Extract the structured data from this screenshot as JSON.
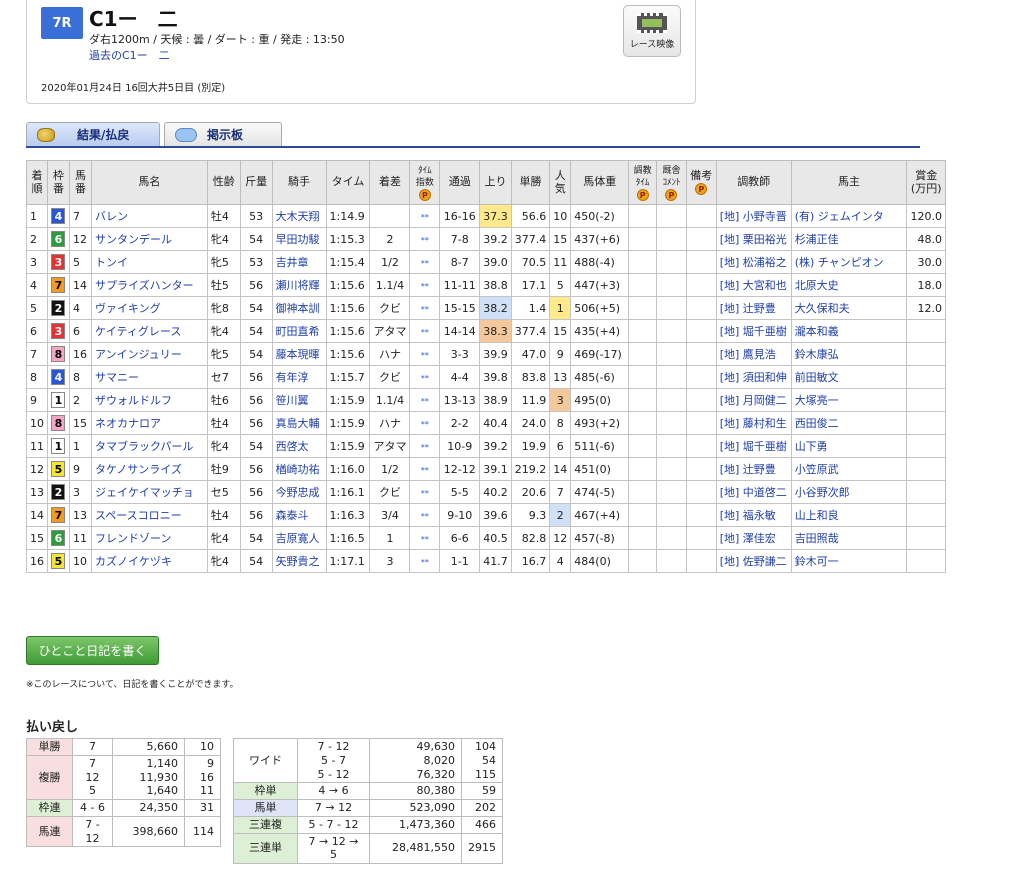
{
  "header": {
    "race_no": "7R",
    "race_name": "C1ー　二",
    "conditions": "ダ右1200m / 天候 : 曇 / ダート : 重 / 発走 : 13:50",
    "past_link": "過去のC1ー　二",
    "date": "2020年01月24日 16回大井5日目 (別定)",
    "video_label": "レース映像"
  },
  "tabs": [
    {
      "label": "結果/払戻"
    },
    {
      "label": "掲示板"
    }
  ],
  "table": {
    "headers": [
      "着順",
      "枠番",
      "馬番",
      "馬名",
      "性齢",
      "斤量",
      "騎手",
      "タイム",
      "着差",
      "タイム指数",
      "通過",
      "上り",
      "単勝",
      "人気",
      "馬体重",
      "調教タイム",
      "厩舎コメント",
      "備考",
      "調教師",
      "馬主",
      "賞金(万円)"
    ],
    "header_display": {
      "chakujun": "着\n順",
      "waku": "枠\n番",
      "uma": "馬\n番",
      "name": "馬名",
      "sexage": "性齢",
      "kinryo": "斤量",
      "jockey": "騎手",
      "time": "タイム",
      "margin": "着差",
      "index": "ﾀｲﾑ\n指数",
      "pass": "通過",
      "agari": "上り",
      "odds": "単勝",
      "pop": "人\n気",
      "weight": "馬体重",
      "chokyo": "調教\nﾀｲﾑ",
      "comment": "厩舎\nｺﾒﾝﾄ",
      "biko": "備考",
      "trainer": "調教師",
      "owner": "馬主",
      "prize": "賞金\n(万円)"
    },
    "p_mark": "P",
    "index_mark": "**",
    "rows": [
      {
        "rank": "1",
        "waku": "4",
        "uma": "7",
        "name": "バレン",
        "sexage": "牡4",
        "kinryo": "53",
        "jockey": "大木天翔",
        "time": "1:14.9",
        "margin": "",
        "pass": "16-16",
        "agari": "37.3",
        "agari_hl": "y",
        "odds": "56.6",
        "pop": "10",
        "pop_hl": "",
        "weight": "450(-2)",
        "trainer": "[地] 小野寺晋",
        "owner": "(有) ジェムインタ",
        "prize": "120.0"
      },
      {
        "rank": "2",
        "waku": "6",
        "uma": "12",
        "name": "サンタンデール",
        "sexage": "牝4",
        "kinryo": "54",
        "jockey": "早田功駿",
        "time": "1:15.3",
        "margin": "2",
        "pass": "7-8",
        "agari": "39.2",
        "agari_hl": "",
        "odds": "377.4",
        "pop": "15",
        "pop_hl": "",
        "weight": "437(+6)",
        "trainer": "[地] 栗田裕光",
        "owner": "杉浦正佳",
        "prize": "48.0"
      },
      {
        "rank": "3",
        "waku": "3",
        "uma": "5",
        "name": "トンイ",
        "sexage": "牝5",
        "kinryo": "53",
        "jockey": "吉井章",
        "time": "1:15.4",
        "margin": "1/2",
        "pass": "8-7",
        "agari": "39.0",
        "agari_hl": "",
        "odds": "70.5",
        "pop": "11",
        "pop_hl": "",
        "weight": "488(-4)",
        "trainer": "[地] 松浦裕之",
        "owner": "(株) チャンピオン",
        "prize": "30.0"
      },
      {
        "rank": "4",
        "waku": "7",
        "uma": "14",
        "name": "サプライズハンター",
        "sexage": "牡5",
        "kinryo": "56",
        "jockey": "瀬川将輝",
        "time": "1:15.6",
        "margin": "1.1/4",
        "pass": "11-11",
        "agari": "38.8",
        "agari_hl": "",
        "odds": "17.1",
        "pop": "5",
        "pop_hl": "",
        "weight": "447(+3)",
        "trainer": "[地] 大宮和也",
        "owner": "北原大史",
        "prize": "18.0"
      },
      {
        "rank": "5",
        "waku": "2",
        "uma": "4",
        "name": "ヴァイキング",
        "sexage": "牝8",
        "kinryo": "54",
        "jockey": "御神本訓",
        "time": "1:15.6",
        "margin": "クビ",
        "pass": "15-15",
        "agari": "38.2",
        "agari_hl": "b",
        "odds": "1.4",
        "pop": "1",
        "pop_hl": "y",
        "weight": "506(+5)",
        "trainer": "[地] 辻野豊",
        "owner": "大久保和夫",
        "prize": "12.0"
      },
      {
        "rank": "6",
        "waku": "3",
        "uma": "6",
        "name": "ケイティグレース",
        "sexage": "牝4",
        "kinryo": "54",
        "jockey": "町田直希",
        "time": "1:15.6",
        "margin": "アタマ",
        "pass": "14-14",
        "agari": "38.3",
        "agari_hl": "o",
        "odds": "377.4",
        "pop": "15",
        "pop_hl": "",
        "weight": "435(+4)",
        "trainer": "[地] 堀千亜樹",
        "owner": "瀧本和義",
        "prize": ""
      },
      {
        "rank": "7",
        "waku": "8",
        "uma": "16",
        "name": "アンインジュリー",
        "sexage": "牝5",
        "kinryo": "54",
        "jockey": "藤本現暉",
        "time": "1:15.6",
        "margin": "ハナ",
        "pass": "3-3",
        "agari": "39.9",
        "agari_hl": "",
        "odds": "47.0",
        "pop": "9",
        "pop_hl": "",
        "weight": "469(-17)",
        "trainer": "[地] 鷹見浩",
        "owner": "鈴木康弘",
        "prize": ""
      },
      {
        "rank": "8",
        "waku": "4",
        "uma": "8",
        "name": "サマニー",
        "sexage": "セ7",
        "kinryo": "56",
        "jockey": "有年淳",
        "time": "1:15.7",
        "margin": "クビ",
        "pass": "4-4",
        "agari": "39.8",
        "agari_hl": "",
        "odds": "83.8",
        "pop": "13",
        "pop_hl": "",
        "weight": "485(-6)",
        "trainer": "[地] 須田和伸",
        "owner": "前田敏文",
        "prize": ""
      },
      {
        "rank": "9",
        "waku": "1",
        "uma": "2",
        "name": "ザウォルドルフ",
        "sexage": "牡6",
        "kinryo": "56",
        "jockey": "笹川翼",
        "time": "1:15.9",
        "margin": "1.1/4",
        "pass": "13-13",
        "agari": "38.9",
        "agari_hl": "",
        "odds": "11.9",
        "pop": "3",
        "pop_hl": "o",
        "weight": "495(0)",
        "trainer": "[地] 月岡健二",
        "owner": "大塚亮一",
        "prize": ""
      },
      {
        "rank": "10",
        "waku": "8",
        "uma": "15",
        "name": "ネオカナロア",
        "sexage": "牡4",
        "kinryo": "56",
        "jockey": "真島大輔",
        "time": "1:15.9",
        "margin": "ハナ",
        "pass": "2-2",
        "agari": "40.4",
        "agari_hl": "",
        "odds": "24.0",
        "pop": "8",
        "pop_hl": "",
        "weight": "493(+2)",
        "trainer": "[地] 藤村和生",
        "owner": "西田俊二",
        "prize": ""
      },
      {
        "rank": "11",
        "waku": "1",
        "uma": "1",
        "name": "タマブラックパール",
        "sexage": "牝4",
        "kinryo": "54",
        "jockey": "西啓太",
        "time": "1:15.9",
        "margin": "アタマ",
        "pass": "10-9",
        "agari": "39.2",
        "agari_hl": "",
        "odds": "19.9",
        "pop": "6",
        "pop_hl": "",
        "weight": "511(-6)",
        "trainer": "[地] 堀千亜樹",
        "owner": "山下勇",
        "prize": ""
      },
      {
        "rank": "12",
        "waku": "5",
        "uma": "9",
        "name": "タケノサンライズ",
        "sexage": "牡9",
        "sexage2": "",
        "kinryo": "56",
        "jockey": "楢崎功祐",
        "time": "1:16.0",
        "margin": "1/2",
        "pass": "12-12",
        "agari": "39.1",
        "agari_hl": "",
        "odds": "219.2",
        "pop": "14",
        "pop_hl": "",
        "weight": "451(0)",
        "trainer": "[地] 辻野豊",
        "owner": "小笠原武",
        "prize": ""
      },
      {
        "rank": "13",
        "waku": "2",
        "uma": "3",
        "name": "ジェイケイマッチョ",
        "sexage": "セ5",
        "kinryo": "56",
        "jockey": "今野忠成",
        "time": "1:16.1",
        "margin": "クビ",
        "pass": "5-5",
        "agari": "40.2",
        "agari_hl": "",
        "odds": "20.6",
        "pop": "7",
        "pop_hl": "",
        "weight": "474(-5)",
        "trainer": "[地] 中道啓二",
        "owner": "小谷野次郎",
        "prize": ""
      },
      {
        "rank": "14",
        "waku": "7",
        "uma": "13",
        "name": "スペースコロニー",
        "sexage": "牡4",
        "kinryo": "56",
        "jockey": "森泰斗",
        "time": "1:16.3",
        "margin": "3/4",
        "pass": "9-10",
        "agari": "39.6",
        "agari_hl": "",
        "odds": "9.3",
        "pop": "2",
        "pop_hl": "b",
        "weight": "467(+4)",
        "trainer": "[地] 福永敏",
        "owner": "山上和良",
        "prize": ""
      },
      {
        "rank": "15",
        "waku": "6",
        "uma": "11",
        "name": "フレンドゾーン",
        "sexage": "牝4",
        "kinryo": "54",
        "jockey": "吉原寛人",
        "time": "1:16.5",
        "margin": "1",
        "pass": "6-6",
        "agari": "40.5",
        "agari_hl": "",
        "odds": "82.8",
        "pop": "12",
        "pop_hl": "",
        "weight": "457(-8)",
        "trainer": "[地] 澤佳宏",
        "owner": "吉田照哉",
        "prize": ""
      },
      {
        "rank": "16",
        "waku": "5",
        "uma": "10",
        "name": "カズノイケヅキ",
        "sexage": "牝4",
        "kinryo": "54",
        "jockey": "矢野貴之",
        "time": "1:17.1",
        "margin": "3",
        "pass": "1-1",
        "agari": "41.7",
        "agari_hl": "",
        "odds": "16.7",
        "pop": "4",
        "pop_hl": "",
        "weight": "484(0)",
        "trainer": "[地] 佐野謙二",
        "owner": "鈴木可一",
        "prize": ""
      }
    ]
  },
  "diary": {
    "button": "ひとこと日記を書く",
    "note": "※このレースについて、日記を書くことができます。"
  },
  "payout": {
    "title": "払い戻し",
    "left": [
      {
        "label": "単勝",
        "combo": "7",
        "amount": "5,660",
        "pop": "10",
        "color": "pink"
      },
      {
        "label": "複勝",
        "combo": "7\n12\n5",
        "amount": "1,140\n11,930\n1,640",
        "pop": "9\n16\n11",
        "color": "pink"
      },
      {
        "label": "枠連",
        "combo": "4 - 6",
        "amount": "24,350",
        "pop": "31",
        "color": "green"
      },
      {
        "label": "馬連",
        "combo": "7 - 12",
        "amount": "398,660",
        "pop": "114",
        "color": "pink"
      }
    ],
    "right": [
      {
        "label": "ワイド",
        "combo": "7 - 12\n5 - 7\n5 - 12",
        "amount": "49,630\n8,020\n76,320",
        "pop": "104\n54\n115",
        "color": "white"
      },
      {
        "label": "枠単",
        "combo": "4 → 6",
        "amount": "80,380",
        "pop": "59",
        "color": "green"
      },
      {
        "label": "馬単",
        "combo": "7 → 12",
        "amount": "523,090",
        "pop": "202",
        "color": "blue"
      },
      {
        "label": "三連複",
        "combo": "5 - 7 - 12",
        "amount": "1,473,360",
        "pop": "466",
        "color": "green"
      },
      {
        "label": "三連単",
        "combo": "7 → 12 → 5",
        "amount": "28,481,550",
        "pop": "2915",
        "color": "green"
      }
    ]
  }
}
